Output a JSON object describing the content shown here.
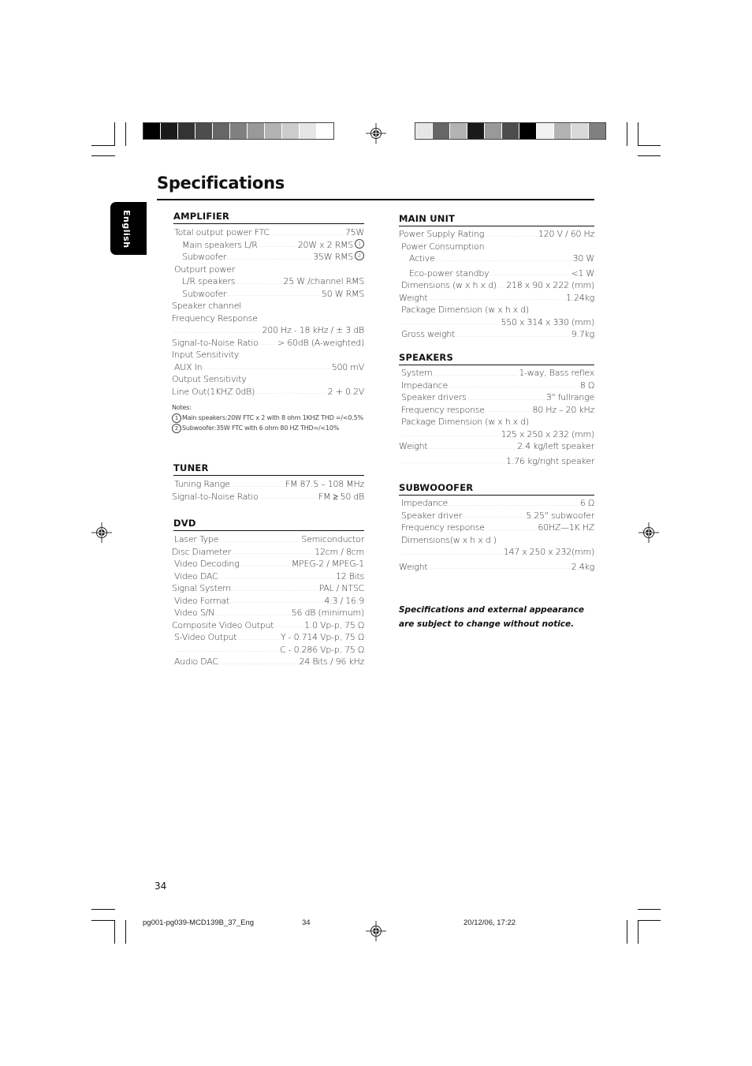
{
  "page": {
    "title": "Specifications",
    "language_tab": "English",
    "page_number": "34",
    "slug": {
      "file": "pg001-pg039-MCD139B_37_Eng",
      "page": "34",
      "datetime": "20/12/06, 17:22"
    },
    "swatches_left": [
      "#000000",
      "#1a1a1a",
      "#333333",
      "#4d4d4d",
      "#666666",
      "#808080",
      "#999999",
      "#b3b3b3",
      "#cccccc",
      "#e6e6e6",
      "#ffffff"
    ],
    "swatches_right": [
      "#e6e6e6",
      "#666666",
      "#b3b3b3",
      "#1a1a1a",
      "#999999",
      "#4d4d4d",
      "#000000",
      "#f2f2f2",
      "#b3b3b3",
      "#d9d9d9",
      "#808080"
    ]
  },
  "amplifier": {
    "heading": "AMPLIFIER",
    "rows": [
      {
        "label": "Total output power FTC",
        "value": "75W"
      },
      {
        "label": "Main speakers L/R",
        "value": "20W x 2 RMS",
        "mark": "1"
      },
      {
        "label": "Subwoofer",
        "value": "35W RMS",
        "mark": "2"
      },
      {
        "label": "Outpurt power",
        "value": ""
      },
      {
        "label": "L/R speakers",
        "value": "25 W /channel RMS"
      },
      {
        "label": "Subwoofer",
        "value": "50 W RMS"
      },
      {
        "label": "Speaker channel",
        "value": ""
      },
      {
        "label": "Frequency Response",
        "value": ""
      },
      {
        "label": "",
        "value": "200 Hz - 18 kHz / ± 3 dB"
      },
      {
        "label": "Signal-to-Noise Ratio",
        "value": "> 60dB (A-weighted)"
      },
      {
        "label": "Input Sensitivity",
        "value": ""
      },
      {
        "label": "AUX In",
        "value": "500 mV"
      },
      {
        "label": "Output Sensitivity",
        "value": ""
      },
      {
        "label": "Line Out(1KHZ 0dB)",
        "value": "2 + 0.2V"
      }
    ],
    "notes_title": "Notes:",
    "notes": [
      {
        "mark": "1",
        "text": "Main speakers:20W FTC x 2 with 8 ohm 1KHZ THD =/<0.5%"
      },
      {
        "mark": "2",
        "text": "Subwoofer:35W FTC with 6 ohm 80 HZ THD=/<10%"
      }
    ]
  },
  "tuner": {
    "heading": "TUNER",
    "rows": [
      {
        "label": "Tuning Range",
        "value": "FM 87.5 – 108 MHz"
      },
      {
        "label": "Signal-to-Noise Ratio",
        "value": "FM ≥ 50 dB"
      }
    ]
  },
  "dvd": {
    "heading": "DVD",
    "rows": [
      {
        "label": "Laser Type",
        "value": "Semiconductor"
      },
      {
        "label": "Disc Diameter",
        "value": "12cm / 8cm"
      },
      {
        "label": "Video Decoding",
        "value": "MPEG-2 / MPEG-1"
      },
      {
        "label": "Video DAC",
        "value": "12 Bits"
      },
      {
        "label": "Signal System",
        "value": "PAL / NTSC"
      },
      {
        "label": "Video Format",
        "value": "4:3 / 16:9"
      },
      {
        "label": "Video S/N",
        "value": "56 dB (minimum)"
      },
      {
        "label": "Composite Video Output",
        "value": "1.0 Vp-p, 75 Ω"
      },
      {
        "label": "S-Video Output",
        "value": "Y - 0.714 Vp-p, 75 Ω"
      },
      {
        "label": "",
        "value": "C - 0.286 Vp-p, 75 Ω"
      },
      {
        "label": "Audio DAC",
        "value": "24 Bits / 96 kHz"
      }
    ]
  },
  "main_unit": {
    "heading": "MAIN UNIT",
    "rows": [
      {
        "label": "Power Supply Rating",
        "value": "120 V / 60 Hz"
      },
      {
        "label": "Power Consumption",
        "value": ""
      },
      {
        "label": "Active",
        "value": "30 W"
      },
      {
        "label": "Eco-power standby",
        "value": "<1 W"
      },
      {
        "label": "Dimensions (w x h x d)",
        "value": "218 x 90 x 222 (mm)"
      },
      {
        "label": "Weight",
        "value": "1.24kg"
      },
      {
        "label": "Package Dimension (w x h  x d)",
        "value": ""
      },
      {
        "label": "",
        "value": "550 x 314 x 330 (mm)"
      },
      {
        "label": "Gross weight",
        "value": "9.7kg"
      }
    ]
  },
  "speakers": {
    "heading": "SPEAKERS",
    "rows": [
      {
        "label": "System",
        "value": "1-way, Bass reflex"
      },
      {
        "label": "Impedance",
        "value": "8 Ω"
      },
      {
        "label": "Speaker drivers",
        "value": "3\" fullrange"
      },
      {
        "label": "Frequency response",
        "value": "80 Hz – 20 kHz"
      },
      {
        "label": "Package Dimension (w x h  x d)",
        "value": ""
      },
      {
        "label": "",
        "value": "125 x 250 x 232 (mm)"
      },
      {
        "label": "Weight",
        "value": "2.4 kg/left speaker"
      },
      {
        "label": "",
        "value": "1.76 kg/right speaker"
      }
    ]
  },
  "subwoofer": {
    "heading": "SUBWOOOFER",
    "rows": [
      {
        "label": "Impedance",
        "value": "6 Ω"
      },
      {
        "label": "Speaker driver",
        "value": "5.25\" subwoofer"
      },
      {
        "label": "Frequency response",
        "value": "60HZ—1K HZ"
      },
      {
        "label": "Dimensions(w x h x d )",
        "value": ""
      },
      {
        "label": "",
        "value": "147 x 250 x 232(mm)"
      },
      {
        "label": "Weight",
        "value": "2.4kg"
      }
    ]
  },
  "disclaimer": "Specifications and external appearance are subject to change without notice."
}
